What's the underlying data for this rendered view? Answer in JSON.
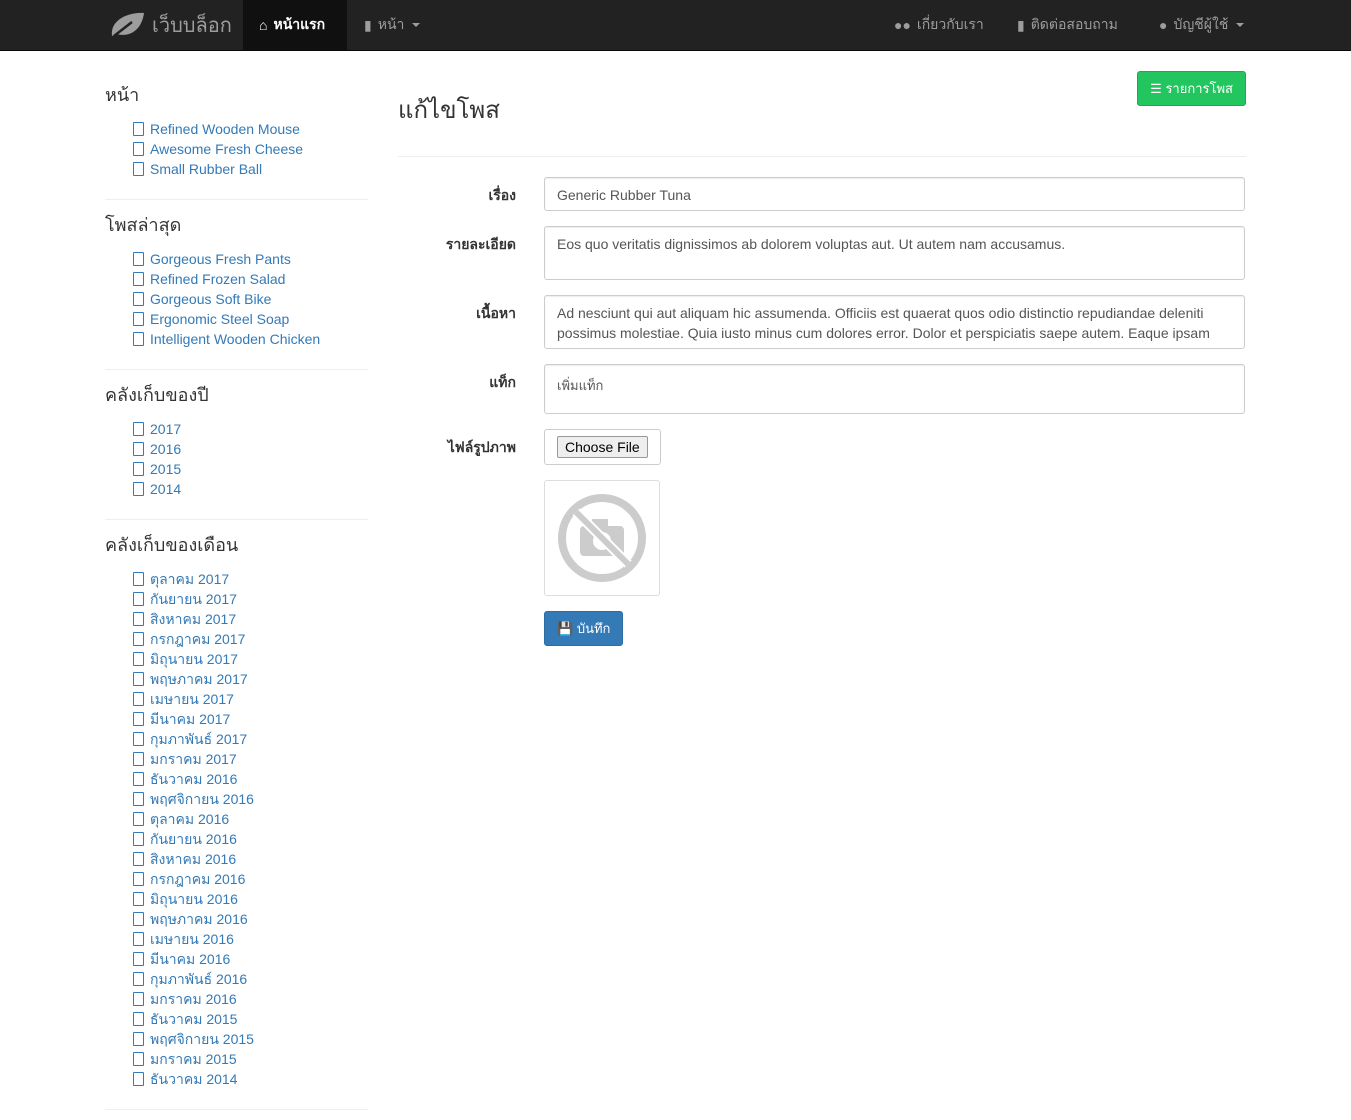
{
  "navbar": {
    "brand": "เว็บบล็อก",
    "home": "หน้าแรก",
    "pages": "หน้า",
    "about": "เกี่ยวกับเรา",
    "contact": "ติดต่อสอบถาม",
    "account": "บัญชีผู้ใช้"
  },
  "sidebar": {
    "pages": {
      "title": "หน้า",
      "items": [
        "Refined Wooden Mouse",
        "Awesome Fresh Cheese",
        "Small Rubber Ball"
      ]
    },
    "recent": {
      "title": "โพสล่าสุด",
      "items": [
        "Gorgeous Fresh Pants",
        "Refined Frozen Salad",
        "Gorgeous Soft Bike",
        "Ergonomic Steel Soap",
        "Intelligent Wooden Chicken"
      ]
    },
    "years": {
      "title": "คลังเก็บของปี",
      "items": [
        "2017",
        "2016",
        "2015",
        "2014"
      ]
    },
    "months": {
      "title": "คลังเก็บของเดือน",
      "items": [
        "ตุลาคม 2017",
        "กันยายน 2017",
        "สิงหาคม 2017",
        "กรกฎาคม 2017",
        "มิถุนายน 2017",
        "พฤษภาคม 2017",
        "เมษายน 2017",
        "มีนาคม 2017",
        "กุมภาพันธ์ 2017",
        "มกราคม 2017",
        "ธันวาคม 2016",
        "พฤศจิกายน 2016",
        "ตุลาคม 2016",
        "กันยายน 2016",
        "สิงหาคม 2016",
        "กรกฎาคม 2016",
        "มิถุนายน 2016",
        "พฤษภาคม 2016",
        "เมษายน 2016",
        "มีนาคม 2016",
        "กุมภาพันธ์ 2016",
        "มกราคม 2016",
        "ธันวาคม 2015",
        "พฤศจิกายน 2015",
        "มกราคม 2015",
        "ธันวาคม 2014"
      ]
    }
  },
  "main": {
    "title": "แก้ไขโพส",
    "list_button": "รายการโพส",
    "form": {
      "title_label": "เรื่อง",
      "title_value": "Generic Rubber Tuna",
      "desc_label": "รายละเอียด",
      "desc_value": "Eos quo veritatis dignissimos ab dolorem voluptas aut. Ut autem nam accusamus.",
      "content_label": "เนื้อหา",
      "content_value": "Ad nesciunt qui aut aliquam hic assumenda. Officiis est quaerat quos odio distinctio repudiandae deleniti possimus molestiae. Quia iusto minus cum dolores error. Dolor et perspiciatis saepe autem. Eaque ipsam",
      "tags_label": "แท็ก",
      "tags_placeholder": "เพิ่มแท็ก",
      "image_label": "ไฟล์รูปภาพ",
      "choose_file": "Choose File",
      "save": "บันทึก"
    }
  }
}
